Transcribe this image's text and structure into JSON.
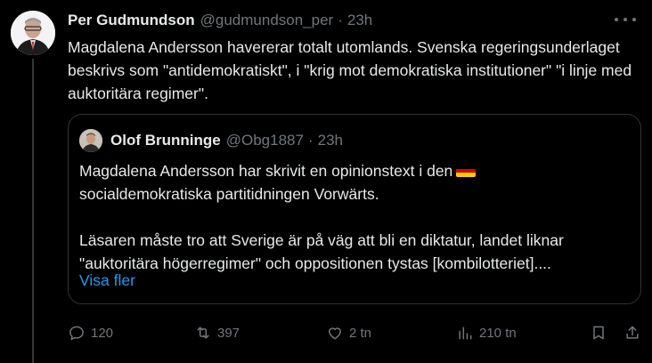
{
  "author": {
    "name": "Per Gudmundson",
    "handle": "@gudmundson_per",
    "separator": "·",
    "time": "23h"
  },
  "tweet": {
    "text": "Magdalena Andersson havererar totalt utomlands. Svenska regeringsunderlaget beskrivs som \"antidemokratiskt\", i \"krig mot demokratiska institutioner\" \"i linje med auktoritära regimer\"."
  },
  "quote": {
    "name": "Olof Brunninge",
    "handle": "@Obg1887",
    "separator": "·",
    "time": "23h",
    "paragraph1": "Magdalena Andersson har skrivit en opinionstext i den",
    "paragraph1_cont": "socialdemokratiska partitidningen Vorwärts.",
    "flag_icon": "german-flag",
    "paragraph2": "Läsaren måste tro att Sverige är på väg att bli en diktatur, landet liknar \"auktoritära högerregimer\" och oppositionen tystas [kombilotteriet]....",
    "show_more": "Visa fler"
  },
  "actions": {
    "replies": "120",
    "retweets": "397",
    "likes": "2 tn",
    "views": "210 tn"
  },
  "colors": {
    "background": "#000000",
    "text": "#e7e9ea",
    "muted": "#71767b",
    "link": "#1d9bf0",
    "border": "#2f3336"
  }
}
